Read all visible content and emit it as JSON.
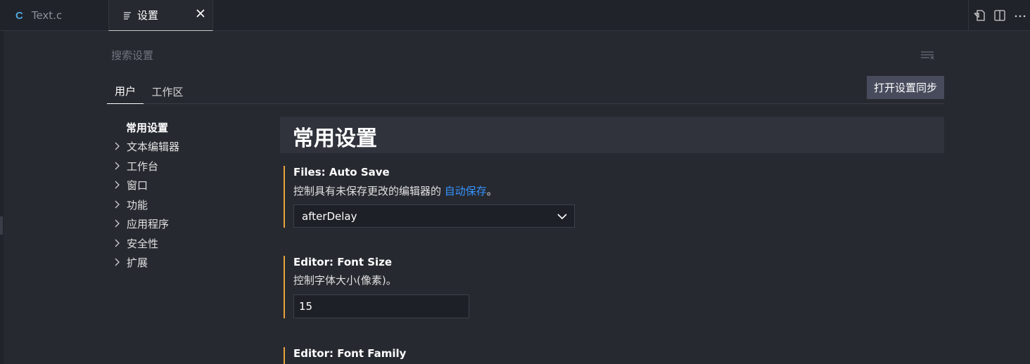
{
  "tabs": {
    "file_tab": {
      "icon_letter": "C",
      "label": "Text.c"
    },
    "settings_tab": {
      "label": "设置"
    }
  },
  "search": {
    "placeholder": "搜索设置"
  },
  "scope": {
    "user": "用户",
    "workspace": "工作区",
    "sync_button": "打开设置同步"
  },
  "toc": {
    "active": "常用设置",
    "items": [
      "文本编辑器",
      "工作台",
      "窗口",
      "功能",
      "应用程序",
      "安全性",
      "扩展"
    ]
  },
  "section": {
    "title": "常用设置"
  },
  "settings": [
    {
      "title": "Files: Auto Save",
      "desc_prefix": "控制具有未保存更改的编辑器的 ",
      "desc_link": "自动保存",
      "desc_suffix": "。",
      "value": "afterDelay"
    },
    {
      "title": "Editor: Font Size",
      "desc": "控制字体大小(像素)。",
      "value": "15"
    },
    {
      "title": "Editor: Font Family"
    }
  ],
  "colors": {
    "accent_modified": "#e8a33c",
    "link": "#3794ff",
    "c_icon": "#4da6d9"
  },
  "icons": {
    "file": "c-language-icon",
    "settings_tab": "settings-lines-icon",
    "close": "close-icon",
    "open_json": "open-settings-json-icon",
    "split": "split-editor-icon",
    "more": "more-actions-icon",
    "filter": "filter-icon",
    "chevron": "chevron-right-icon",
    "dropdown": "chevron-down-icon"
  }
}
